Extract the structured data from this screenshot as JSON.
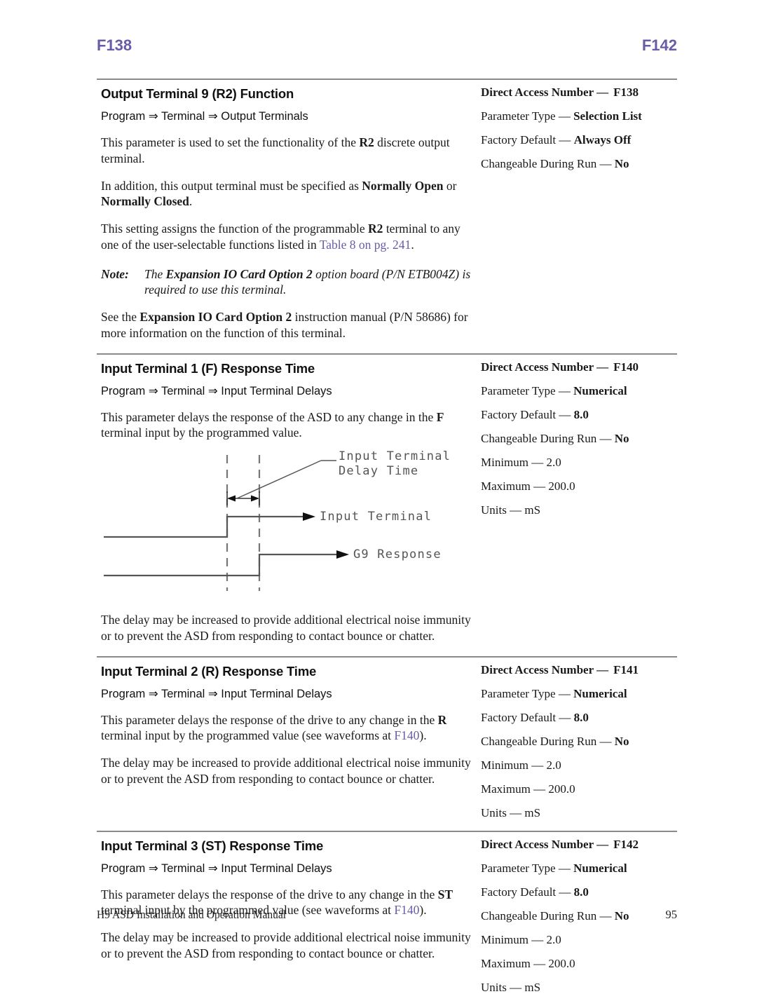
{
  "runhead": {
    "left": "F138",
    "right": "F142",
    "color": "#6a5aa8"
  },
  "sections": [
    {
      "title": "Output Terminal 9 (R2) Function",
      "path": "Program ⇒ Terminal ⇒ Output Terminals",
      "paragraphs": [
        "This parameter is used to set the functionality of the R2 discrete output terminal.",
        "In addition, this output terminal must be specified as Normally Open or Normally Closed.",
        "This setting assigns the function of the programmable R2 terminal to any one of the user-selectable functions listed in Table 8 on pg. 241.",
        "See the Expansion IO Card Option 2 instruction manual (P/N 58686) for more information on the function of this terminal."
      ],
      "note": {
        "label": "Note:",
        "text": "The Expansion IO Card Option 2 option board (P/N ETB004Z) is required to use this terminal."
      },
      "link_text": "Table 8 on pg. 241",
      "attributes": [
        {
          "key": "Direct Access Number —",
          "value": "F138",
          "key_bold": true
        },
        {
          "key": "Parameter Type —",
          "value": "Selection List",
          "key_bold": false
        },
        {
          "key": "Factory Default —",
          "value": "Always Off",
          "key_bold": false
        },
        {
          "key": "Changeable During Run —",
          "value": "No",
          "key_bold": false
        }
      ]
    },
    {
      "title": "Input Terminal 1 (F) Response Time",
      "path": "Program ⇒ Terminal ⇒ Input Terminal Delays",
      "paragraphs": [
        "This parameter delays the response of the ASD to any change in the F terminal input by the programmed value.",
        "The delay may be increased to provide additional electrical noise immunity or to prevent the ASD from responding to contact bounce or chatter."
      ],
      "attributes": [
        {
          "key": "Direct Access Number —",
          "value": "F140",
          "key_bold": true
        },
        {
          "key": "Parameter Type —",
          "value": "Numerical",
          "key_bold": false
        },
        {
          "key": "Factory Default —",
          "value": "8.0",
          "key_bold": false
        },
        {
          "key": "Changeable During Run —",
          "value": "No",
          "key_bold": false
        },
        {
          "key": "Minimum —",
          "value": "2.0",
          "key_bold": false,
          "value_bold": false
        },
        {
          "key": "Maximum —",
          "value": "200.0",
          "key_bold": false,
          "value_bold": false
        },
        {
          "key": "Units —",
          "value": "mS",
          "key_bold": false,
          "value_bold": false
        }
      ]
    },
    {
      "title": "Input Terminal 2 (R) Response Time",
      "path": "Program ⇒ Terminal ⇒ Input Terminal Delays",
      "paragraphs": [
        "This parameter delays the response of the drive to any change in the R terminal input by the programmed value (see waveforms at F140).",
        "The delay may be increased to provide additional electrical noise immunity or to prevent the ASD from responding to contact bounce or chatter."
      ],
      "link_text": "F140",
      "attributes": [
        {
          "key": "Direct Access Number —",
          "value": "F141",
          "key_bold": true
        },
        {
          "key": "Parameter Type —",
          "value": "Numerical",
          "key_bold": false
        },
        {
          "key": "Factory Default —",
          "value": "8.0",
          "key_bold": false
        },
        {
          "key": "Changeable During Run —",
          "value": "No",
          "key_bold": false
        },
        {
          "key": "Minimum —",
          "value": "2.0",
          "key_bold": false,
          "value_bold": false
        },
        {
          "key": "Maximum —",
          "value": "200.0",
          "key_bold": false,
          "value_bold": false
        },
        {
          "key": "Units —",
          "value": "mS",
          "key_bold": false,
          "value_bold": false
        }
      ]
    },
    {
      "title": "Input Terminal 3 (ST) Response Time",
      "path": "Program ⇒ Terminal ⇒ Input Terminal Delays",
      "paragraphs": [
        "This parameter delays the response of the drive to any change in the ST terminal input by the programmed value (see waveforms at F140).",
        "The delay may be increased to provide additional electrical noise immunity or to prevent the ASD from responding to contact bounce or chatter."
      ],
      "link_text": "F140",
      "attributes": [
        {
          "key": "Direct Access Number —",
          "value": "F142",
          "key_bold": true
        },
        {
          "key": "Parameter Type —",
          "value": "Numerical",
          "key_bold": false
        },
        {
          "key": "Factory Default —",
          "value": "8.0",
          "key_bold": false
        },
        {
          "key": "Changeable During Run —",
          "value": "No",
          "key_bold": false
        },
        {
          "key": "Minimum —",
          "value": "2.0",
          "key_bold": false,
          "value_bold": false
        },
        {
          "key": "Maximum —",
          "value": "200.0",
          "key_bold": false,
          "value_bold": false
        },
        {
          "key": "Units —",
          "value": "mS",
          "key_bold": false,
          "value_bold": false
        }
      ]
    }
  ],
  "figure": {
    "labels": {
      "delay_time_line1": "Input Terminal",
      "delay_time_line2": "Delay Time",
      "input_terminal": "Input Terminal",
      "g9_response": "G9 Response"
    }
  },
  "footer": {
    "left": "H9 ASD Installation and Operation Manual",
    "page": "95"
  }
}
